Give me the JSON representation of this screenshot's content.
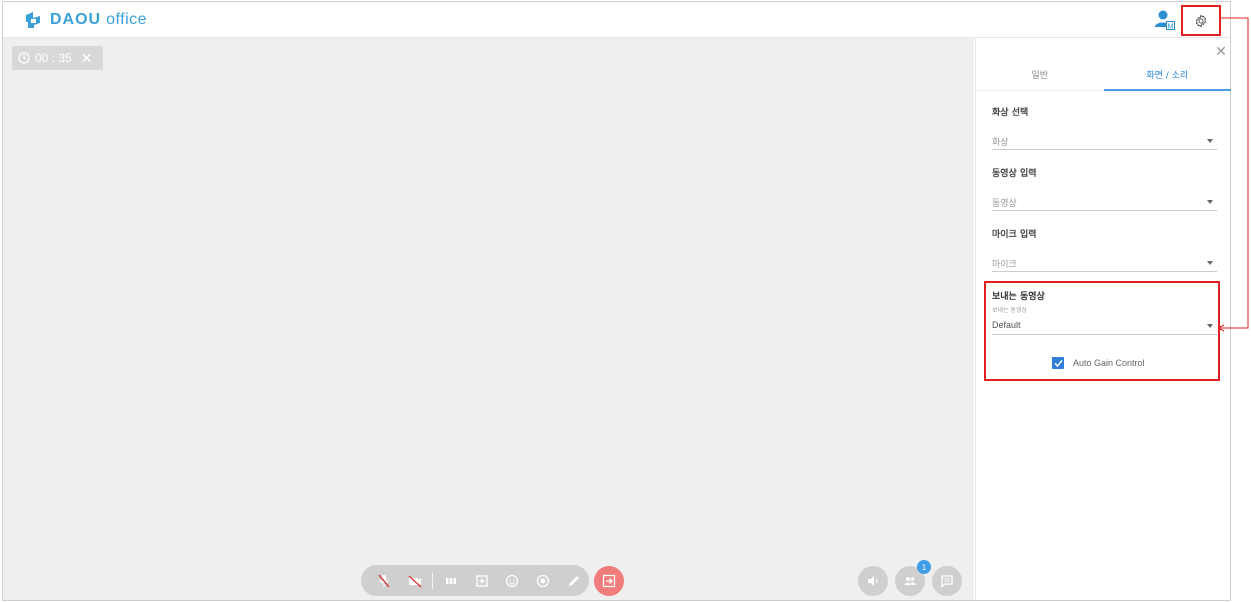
{
  "brand": {
    "name_bold": "DAOU",
    "name_light": "office",
    "color": "#3aa0d8"
  },
  "header": {
    "user_icon": "user-admin-icon",
    "settings_icon": "gear-icon"
  },
  "call": {
    "timer": "00 : 35"
  },
  "toolbar": {
    "items": [
      "mic-off-icon",
      "camera-off-icon",
      "grid-layout-icon",
      "add-screen-icon",
      "emoji-icon",
      "record-icon",
      "pen-icon"
    ],
    "exit_icon": "exit-icon",
    "exit_color": "#f07c7c"
  },
  "right_controls": {
    "volume_icon": "speaker-icon",
    "participants_icon": "participants-icon",
    "participants_count": "1",
    "chat_icon": "chat-icon"
  },
  "settings_panel": {
    "tabs": [
      {
        "label": "일반",
        "active": false
      },
      {
        "label": "화면 / 소리",
        "active": true
      }
    ],
    "fields": [
      {
        "title": "화상 선택",
        "value": "화상"
      },
      {
        "title": "동영상 입력",
        "value": "동영상"
      },
      {
        "title": "마이크 입력",
        "value": "마이크"
      }
    ],
    "send_video": {
      "title": "보내는 동영상",
      "sublabel": "보내는 동영상",
      "value": "Default"
    },
    "auto_gain": {
      "label": "Auto Gain Control",
      "checked": true
    },
    "accent": "#2a86d8",
    "highlight": "#e02020"
  }
}
